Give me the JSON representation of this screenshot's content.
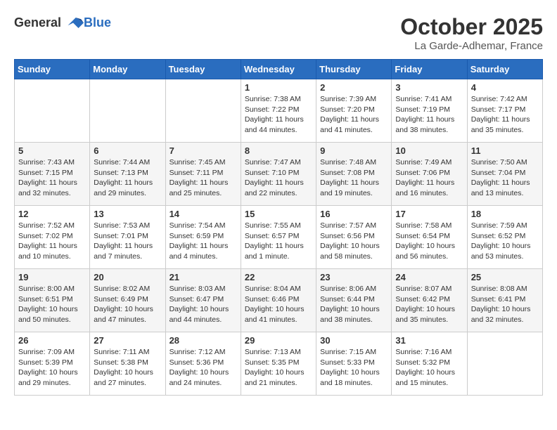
{
  "header": {
    "logo_general": "General",
    "logo_blue": "Blue",
    "month": "October 2025",
    "location": "La Garde-Adhemar, France"
  },
  "weekdays": [
    "Sunday",
    "Monday",
    "Tuesday",
    "Wednesday",
    "Thursday",
    "Friday",
    "Saturday"
  ],
  "weeks": [
    [
      {
        "day": "",
        "info": ""
      },
      {
        "day": "",
        "info": ""
      },
      {
        "day": "",
        "info": ""
      },
      {
        "day": "1",
        "info": "Sunrise: 7:38 AM\nSunset: 7:22 PM\nDaylight: 11 hours\nand 44 minutes."
      },
      {
        "day": "2",
        "info": "Sunrise: 7:39 AM\nSunset: 7:20 PM\nDaylight: 11 hours\nand 41 minutes."
      },
      {
        "day": "3",
        "info": "Sunrise: 7:41 AM\nSunset: 7:19 PM\nDaylight: 11 hours\nand 38 minutes."
      },
      {
        "day": "4",
        "info": "Sunrise: 7:42 AM\nSunset: 7:17 PM\nDaylight: 11 hours\nand 35 minutes."
      }
    ],
    [
      {
        "day": "5",
        "info": "Sunrise: 7:43 AM\nSunset: 7:15 PM\nDaylight: 11 hours\nand 32 minutes."
      },
      {
        "day": "6",
        "info": "Sunrise: 7:44 AM\nSunset: 7:13 PM\nDaylight: 11 hours\nand 29 minutes."
      },
      {
        "day": "7",
        "info": "Sunrise: 7:45 AM\nSunset: 7:11 PM\nDaylight: 11 hours\nand 25 minutes."
      },
      {
        "day": "8",
        "info": "Sunrise: 7:47 AM\nSunset: 7:10 PM\nDaylight: 11 hours\nand 22 minutes."
      },
      {
        "day": "9",
        "info": "Sunrise: 7:48 AM\nSunset: 7:08 PM\nDaylight: 11 hours\nand 19 minutes."
      },
      {
        "day": "10",
        "info": "Sunrise: 7:49 AM\nSunset: 7:06 PM\nDaylight: 11 hours\nand 16 minutes."
      },
      {
        "day": "11",
        "info": "Sunrise: 7:50 AM\nSunset: 7:04 PM\nDaylight: 11 hours\nand 13 minutes."
      }
    ],
    [
      {
        "day": "12",
        "info": "Sunrise: 7:52 AM\nSunset: 7:02 PM\nDaylight: 11 hours\nand 10 minutes."
      },
      {
        "day": "13",
        "info": "Sunrise: 7:53 AM\nSunset: 7:01 PM\nDaylight: 11 hours\nand 7 minutes."
      },
      {
        "day": "14",
        "info": "Sunrise: 7:54 AM\nSunset: 6:59 PM\nDaylight: 11 hours\nand 4 minutes."
      },
      {
        "day": "15",
        "info": "Sunrise: 7:55 AM\nSunset: 6:57 PM\nDaylight: 11 hours\nand 1 minute."
      },
      {
        "day": "16",
        "info": "Sunrise: 7:57 AM\nSunset: 6:56 PM\nDaylight: 10 hours\nand 58 minutes."
      },
      {
        "day": "17",
        "info": "Sunrise: 7:58 AM\nSunset: 6:54 PM\nDaylight: 10 hours\nand 56 minutes."
      },
      {
        "day": "18",
        "info": "Sunrise: 7:59 AM\nSunset: 6:52 PM\nDaylight: 10 hours\nand 53 minutes."
      }
    ],
    [
      {
        "day": "19",
        "info": "Sunrise: 8:00 AM\nSunset: 6:51 PM\nDaylight: 10 hours\nand 50 minutes."
      },
      {
        "day": "20",
        "info": "Sunrise: 8:02 AM\nSunset: 6:49 PM\nDaylight: 10 hours\nand 47 minutes."
      },
      {
        "day": "21",
        "info": "Sunrise: 8:03 AM\nSunset: 6:47 PM\nDaylight: 10 hours\nand 44 minutes."
      },
      {
        "day": "22",
        "info": "Sunrise: 8:04 AM\nSunset: 6:46 PM\nDaylight: 10 hours\nand 41 minutes."
      },
      {
        "day": "23",
        "info": "Sunrise: 8:06 AM\nSunset: 6:44 PM\nDaylight: 10 hours\nand 38 minutes."
      },
      {
        "day": "24",
        "info": "Sunrise: 8:07 AM\nSunset: 6:42 PM\nDaylight: 10 hours\nand 35 minutes."
      },
      {
        "day": "25",
        "info": "Sunrise: 8:08 AM\nSunset: 6:41 PM\nDaylight: 10 hours\nand 32 minutes."
      }
    ],
    [
      {
        "day": "26",
        "info": "Sunrise: 7:09 AM\nSunset: 5:39 PM\nDaylight: 10 hours\nand 29 minutes."
      },
      {
        "day": "27",
        "info": "Sunrise: 7:11 AM\nSunset: 5:38 PM\nDaylight: 10 hours\nand 27 minutes."
      },
      {
        "day": "28",
        "info": "Sunrise: 7:12 AM\nSunset: 5:36 PM\nDaylight: 10 hours\nand 24 minutes."
      },
      {
        "day": "29",
        "info": "Sunrise: 7:13 AM\nSunset: 5:35 PM\nDaylight: 10 hours\nand 21 minutes."
      },
      {
        "day": "30",
        "info": "Sunrise: 7:15 AM\nSunset: 5:33 PM\nDaylight: 10 hours\nand 18 minutes."
      },
      {
        "day": "31",
        "info": "Sunrise: 7:16 AM\nSunset: 5:32 PM\nDaylight: 10 hours\nand 15 minutes."
      },
      {
        "day": "",
        "info": ""
      }
    ]
  ]
}
